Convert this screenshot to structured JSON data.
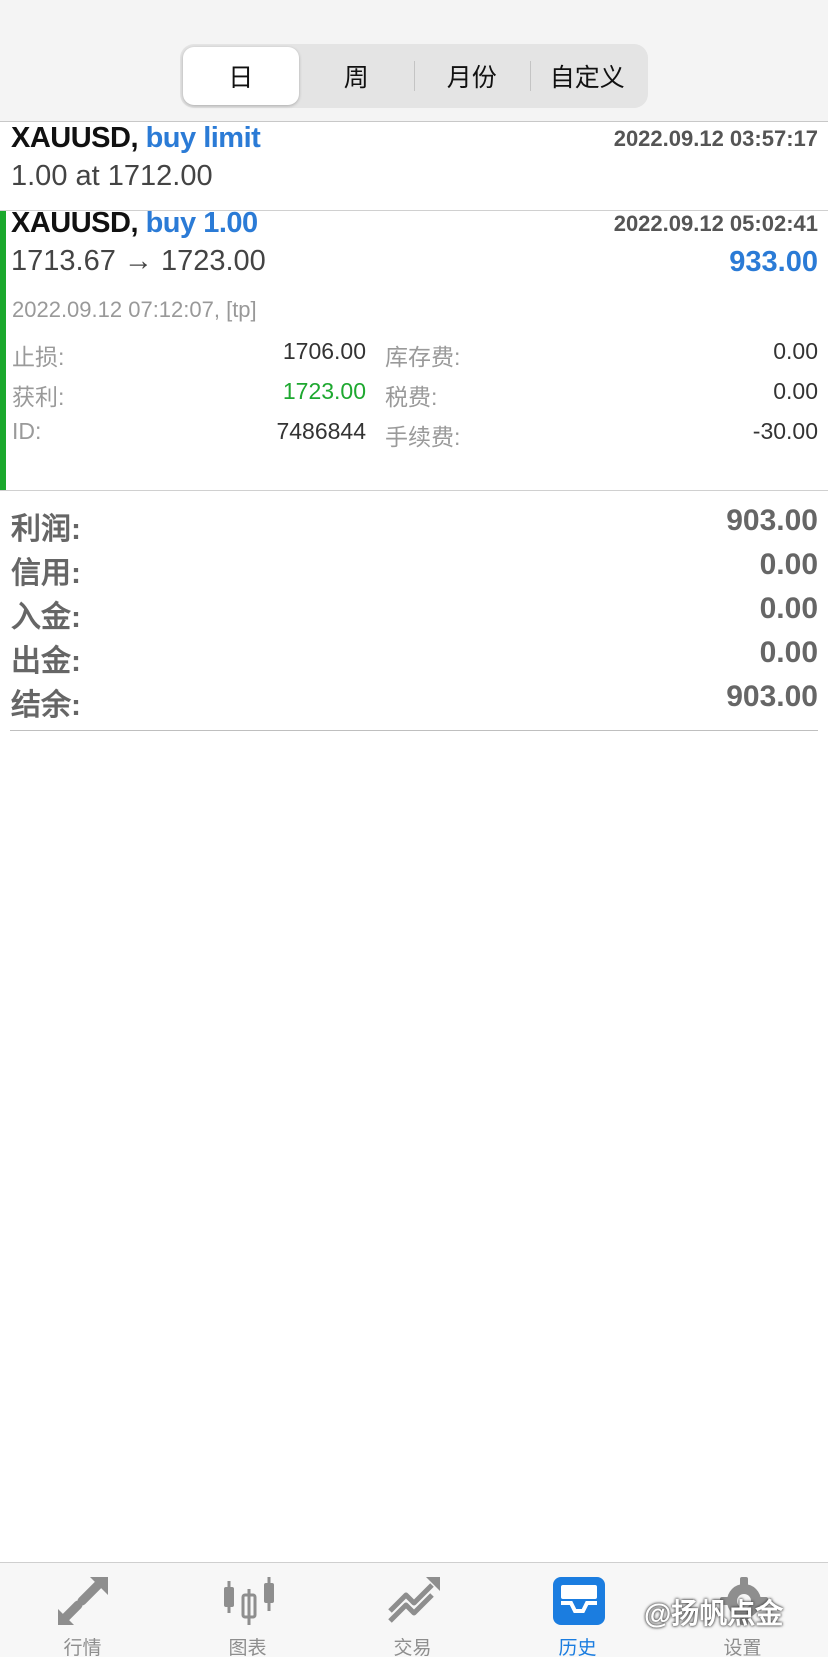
{
  "period_tabs": [
    "日",
    "周",
    "月份",
    "自定义"
  ],
  "active_period": 0,
  "order": {
    "symbol": "XAUUSD,",
    "action": "buy limit",
    "time": "2022.09.12 03:57:17",
    "detail": "1.00 at 1712.00"
  },
  "deal": {
    "symbol": "XAUUSD,",
    "action": "buy 1.00",
    "time": "2022.09.12 05:02:41",
    "prices": "1713.67 → 1723.00",
    "profit": "933.00",
    "close_time": "2022.09.12 07:12:07, [tp]",
    "sl_label": "止损:",
    "sl_value": "1706.00",
    "tp_label": "获利:",
    "tp_value": "1723.00",
    "id_label": "ID:",
    "id_value": "7486844",
    "swap_label": "库存费:",
    "swap_value": "0.00",
    "tax_label": "税费:",
    "tax_value": "0.00",
    "commission_label": "手续费:",
    "commission_value": "-30.00"
  },
  "summary": [
    {
      "label": "利润:",
      "value": "903.00"
    },
    {
      "label": "信用:",
      "value": "0.00"
    },
    {
      "label": "入金:",
      "value": "0.00"
    },
    {
      "label": "出金:",
      "value": "0.00"
    },
    {
      "label": "结余:",
      "value": "903.00"
    }
  ],
  "tabbar": [
    {
      "label": "行情",
      "icon": "quotes-arrows-icon"
    },
    {
      "label": "图表",
      "icon": "candlestick-chart-icon"
    },
    {
      "label": "交易",
      "icon": "trade-trend-icon"
    },
    {
      "label": "历史",
      "icon": "history-inbox-icon"
    },
    {
      "label": "设置",
      "icon": "gear-icon"
    }
  ],
  "active_tab": 3,
  "watermark": "@扬帆点金",
  "colors": {
    "accent_blue": "#2b7bd6",
    "profit_green": "#1ea830",
    "deal_bar": "#1aa82c",
    "tab_active": "#1b7de0",
    "tab_inactive": "#8e8e8e"
  }
}
